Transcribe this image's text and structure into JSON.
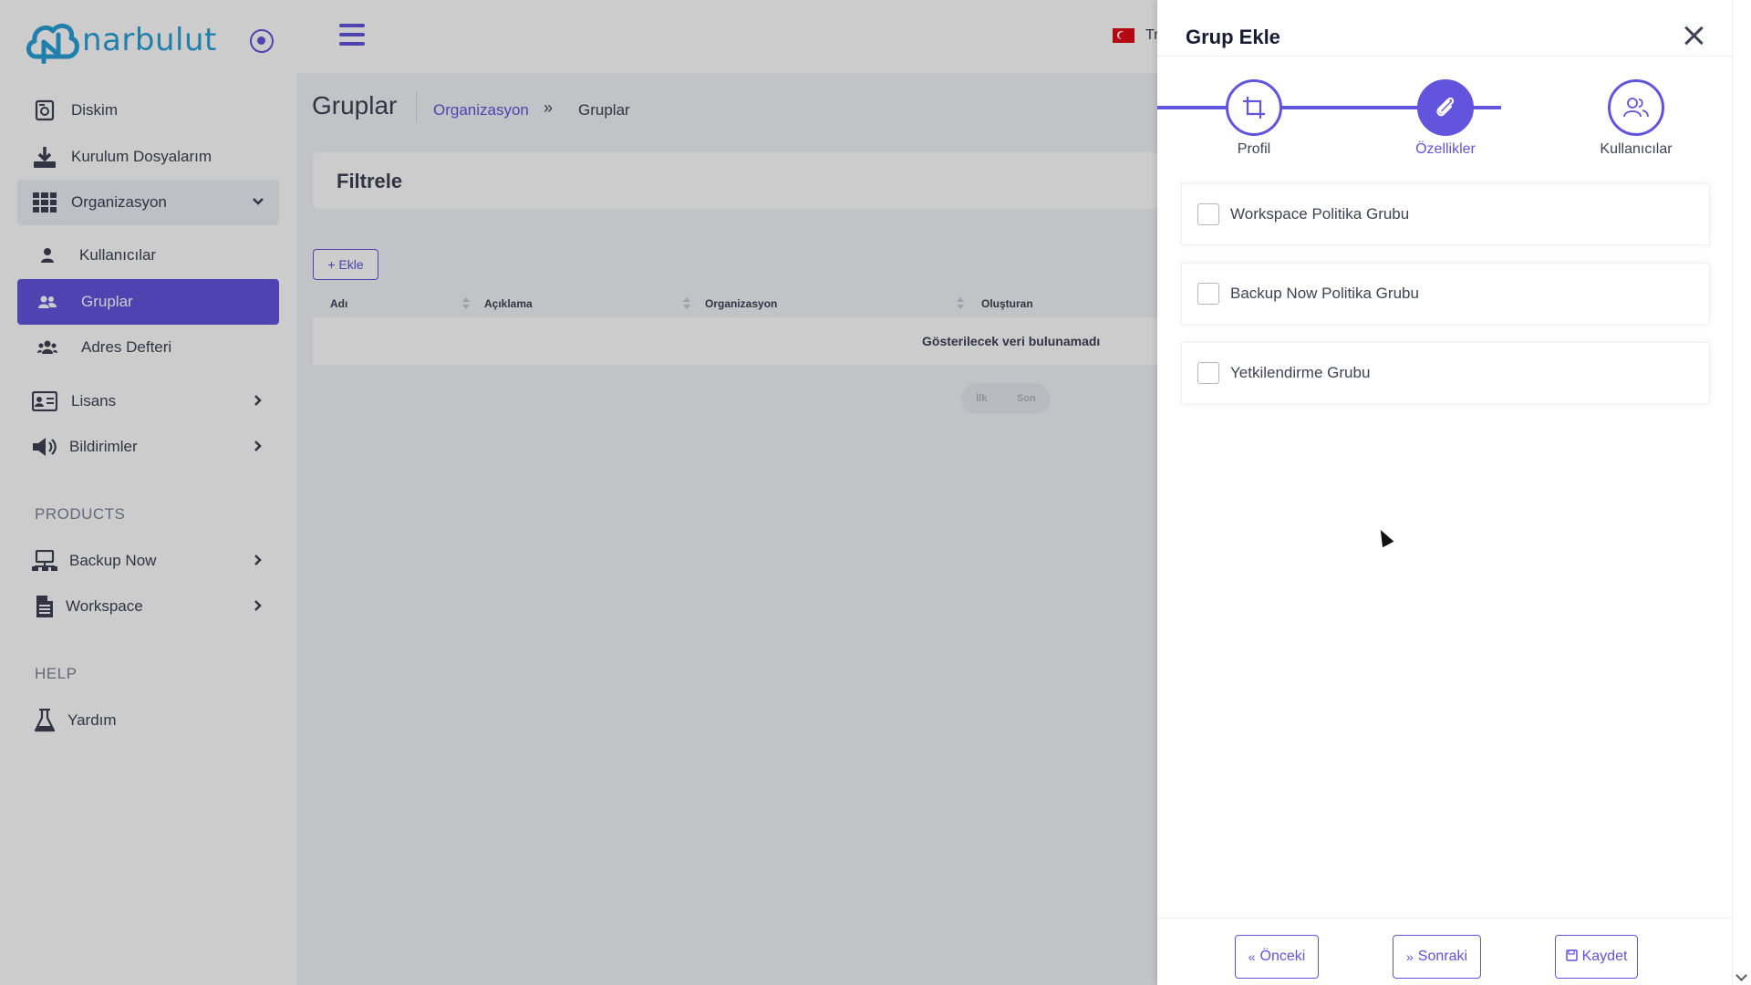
{
  "brand": {
    "name": "narbulut",
    "accent": "#6254dc",
    "logo_color": "#2aa1d6"
  },
  "sidebar": {
    "items": [
      {
        "label": "Diskim",
        "icon": "hdd-icon"
      },
      {
        "label": "Kurulum Dosyalarım",
        "icon": "download-icon"
      },
      {
        "label": "Organizasyon",
        "icon": "grid-icon"
      },
      {
        "label": "Kullanıcılar",
        "icon": "user-icon"
      },
      {
        "label": "Gruplar",
        "icon": "users-icon"
      },
      {
        "label": "Adres Defteri",
        "icon": "users-group-icon"
      },
      {
        "label": "Lisans",
        "icon": "id-card-icon"
      },
      {
        "label": "Bildirimler",
        "icon": "megaphone-icon"
      },
      {
        "label": "Backup Now",
        "icon": "network-icon"
      },
      {
        "label": "Workspace",
        "icon": "file-icon"
      },
      {
        "label": "Yardım",
        "icon": "flask-icon"
      }
    ],
    "sections": {
      "products": "PRODUCTS",
      "help": "HELP"
    }
  },
  "topbar": {
    "lang_label": "Tr"
  },
  "page": {
    "title": "Gruplar",
    "breadcrumb": {
      "parent": "Organizasyon",
      "separator": "»",
      "current": "Gruplar"
    },
    "filter_title": "Filtrele",
    "add_button": "+ Ekle",
    "table": {
      "columns": [
        "Adı",
        "Açıklama",
        "Organizasyon",
        "Oluşturan"
      ],
      "empty_message": "Gösterilecek veri bulunamadı"
    },
    "pager": {
      "first": "İlk",
      "last": "Son"
    }
  },
  "drawer": {
    "title": "Grup Ekle",
    "steps": [
      {
        "label": "Profil",
        "icon": "crop-icon"
      },
      {
        "label": "Özellikler",
        "icon": "paperclip-icon"
      },
      {
        "label": "Kullanıcılar",
        "icon": "users-icon"
      }
    ],
    "options": [
      {
        "label": "Workspace Politika Grubu",
        "checked": false
      },
      {
        "label": "Backup Now Politika Grubu",
        "checked": false
      },
      {
        "label": "Yetkilendirme Grubu",
        "checked": false
      }
    ],
    "buttons": {
      "prev": "Önceki",
      "next": "Sonraki",
      "save": "Kaydet"
    }
  }
}
